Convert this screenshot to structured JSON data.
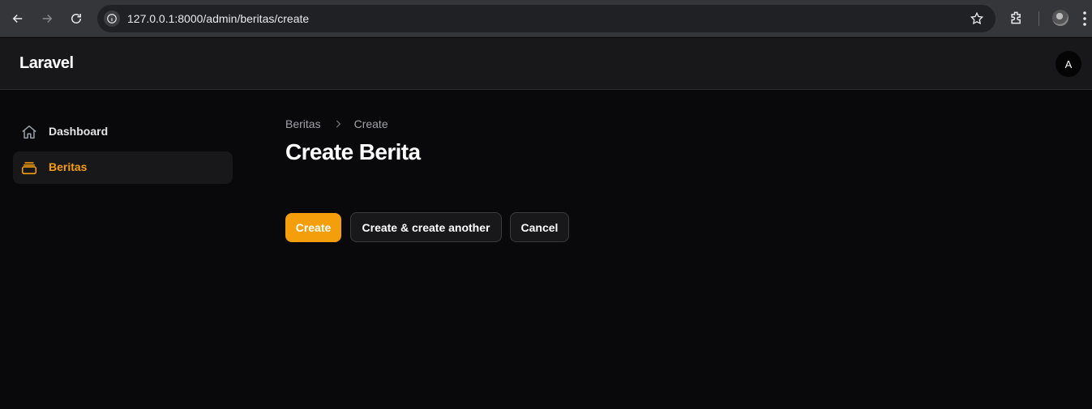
{
  "browser": {
    "url": "127.0.0.1:8000/admin/beritas/create"
  },
  "header": {
    "brand": "Laravel",
    "avatar_initial": "A"
  },
  "sidebar": {
    "items": [
      {
        "label": "Dashboard",
        "icon": "home-icon",
        "active": false
      },
      {
        "label": "Beritas",
        "icon": "inbox-stack-icon",
        "active": true
      }
    ],
    "active_color": "#f59e0b"
  },
  "main": {
    "breadcrumb": [
      "Beritas",
      "Create"
    ],
    "title": "Create Berita",
    "actions": {
      "create": "Create",
      "create_another": "Create & create another",
      "cancel": "Cancel"
    }
  },
  "colors": {
    "primary": "#f59e0b",
    "background": "#09090b",
    "surface": "#18181b"
  }
}
